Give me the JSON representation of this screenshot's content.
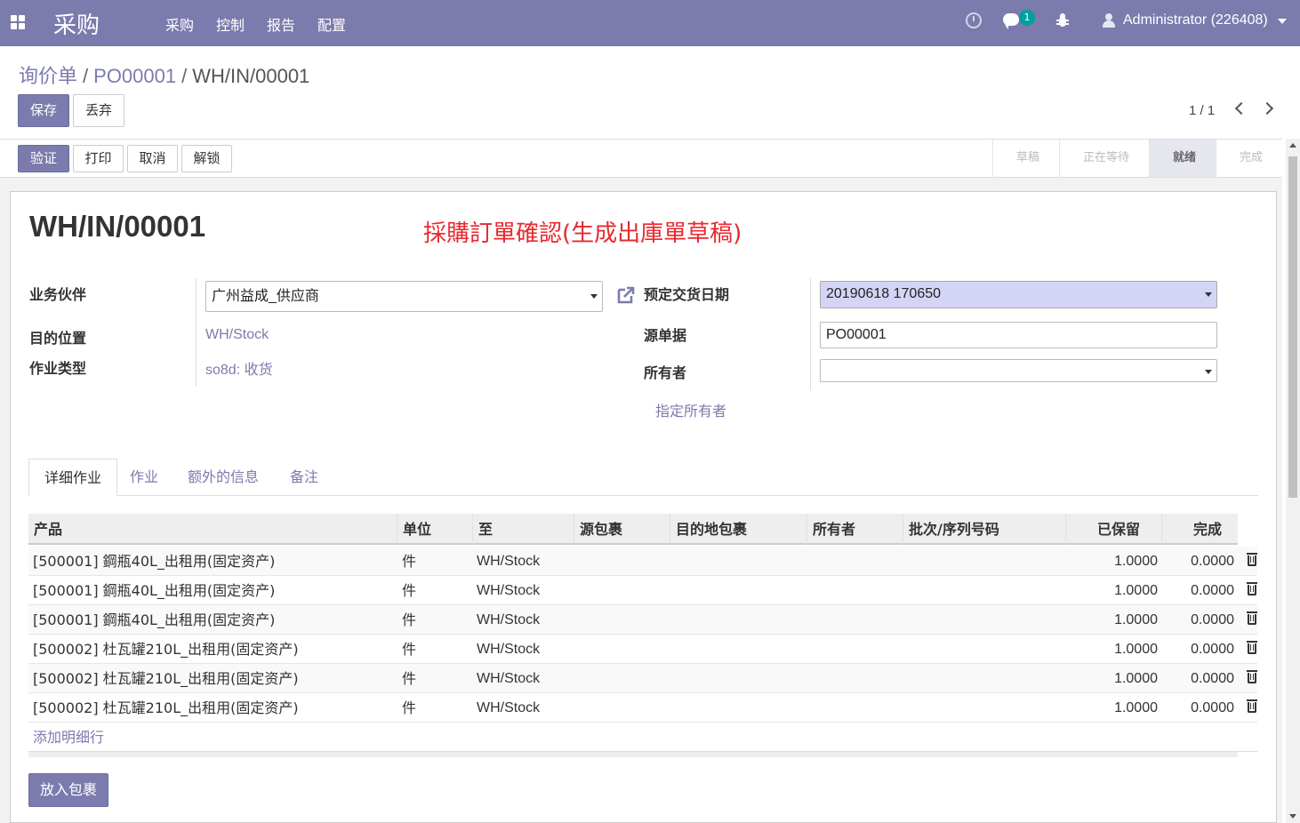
{
  "navbar": {
    "brand": "采购",
    "menu": [
      "采购",
      "控制",
      "报告",
      "配置"
    ],
    "message_badge": "1",
    "user": "Administrator (226408)"
  },
  "breadcrumb": {
    "root": "询价单",
    "middle": "PO00001",
    "current": "WH/IN/00001"
  },
  "actions": {
    "save": "保存",
    "discard": "丢弃"
  },
  "pager": {
    "value": "1 / 1"
  },
  "statusbar": {
    "buttons": [
      "验证",
      "打印",
      "取消",
      "解锁"
    ],
    "stages": [
      "草稿",
      "正在等待",
      "就绪",
      "完成"
    ],
    "active_stage": "就绪"
  },
  "form": {
    "title": "WH/IN/00001",
    "annotation": "採購訂單確認(生成出庫單草稿)",
    "partner_label": "业务伙伴",
    "partner_value": "广州益成_供应商",
    "dest_label": "目的位置",
    "dest_value": "WH/Stock",
    "optype_label": "作业类型",
    "optype_value": "so8d: 收货",
    "scheduled_label": "预定交货日期",
    "scheduled_value": "20190618 170650",
    "origin_label": "源单据",
    "origin_value": "PO00001",
    "owner_label": "所有者",
    "owner_value": "",
    "assign_owner": "指定所有者"
  },
  "tabs": [
    "详细作业",
    "作业",
    "额外的信息",
    "备注"
  ],
  "table": {
    "headers": [
      "产品",
      "单位",
      "至",
      "源包裹",
      "目的地包裹",
      "所有者",
      "批次/序列号码",
      "已保留",
      "完成"
    ],
    "rows": [
      {
        "product": "[500001] 鋼瓶40L_出租用(固定资产)",
        "uom": "件",
        "to": "WH/Stock",
        "reserved": "1.0000",
        "done": "0.0000"
      },
      {
        "product": "[500001] 鋼瓶40L_出租用(固定资产)",
        "uom": "件",
        "to": "WH/Stock",
        "reserved": "1.0000",
        "done": "0.0000"
      },
      {
        "product": "[500001] 鋼瓶40L_出租用(固定资产)",
        "uom": "件",
        "to": "WH/Stock",
        "reserved": "1.0000",
        "done": "0.0000"
      },
      {
        "product": "[500002] 杜瓦罐210L_出租用(固定资产)",
        "uom": "件",
        "to": "WH/Stock",
        "reserved": "1.0000",
        "done": "0.0000"
      },
      {
        "product": "[500002] 杜瓦罐210L_出租用(固定资产)",
        "uom": "件",
        "to": "WH/Stock",
        "reserved": "1.0000",
        "done": "0.0000"
      },
      {
        "product": "[500002] 杜瓦罐210L_出租用(固定资产)",
        "uom": "件",
        "to": "WH/Stock",
        "reserved": "1.0000",
        "done": "0.0000"
      }
    ],
    "add_line": "添加明细行"
  },
  "put_in_pack": "放入包裹",
  "colors": {
    "brand": "#7c7bad",
    "annotation": "#e8282e",
    "highlight_input": "#d4d4f6"
  }
}
